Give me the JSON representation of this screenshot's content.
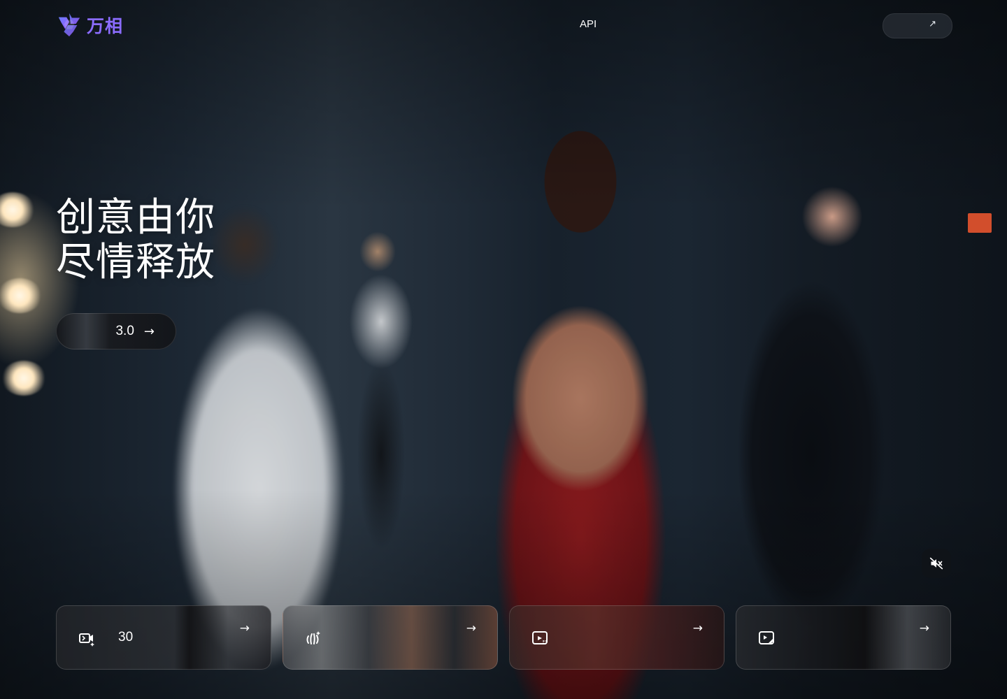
{
  "header": {
    "brand": "万相",
    "nav_api": "API",
    "cta_label": ""
  },
  "hero": {
    "title_line1": "创意由你",
    "title_line2": "尽情释放",
    "cta_version": "3.0"
  },
  "cards": [
    {
      "icon": "video-sparkle-icon",
      "label": "30"
    },
    {
      "icon": "hand-sparkle-icon",
      "label": ""
    },
    {
      "icon": "video-frame-icon",
      "label": ""
    },
    {
      "icon": "video-edit-icon",
      "label": ""
    }
  ],
  "media_controls": {
    "mute_icon": "muted-speaker-icon"
  },
  "colors": {
    "brand": "#8b6cff",
    "text": "#ffffff"
  }
}
